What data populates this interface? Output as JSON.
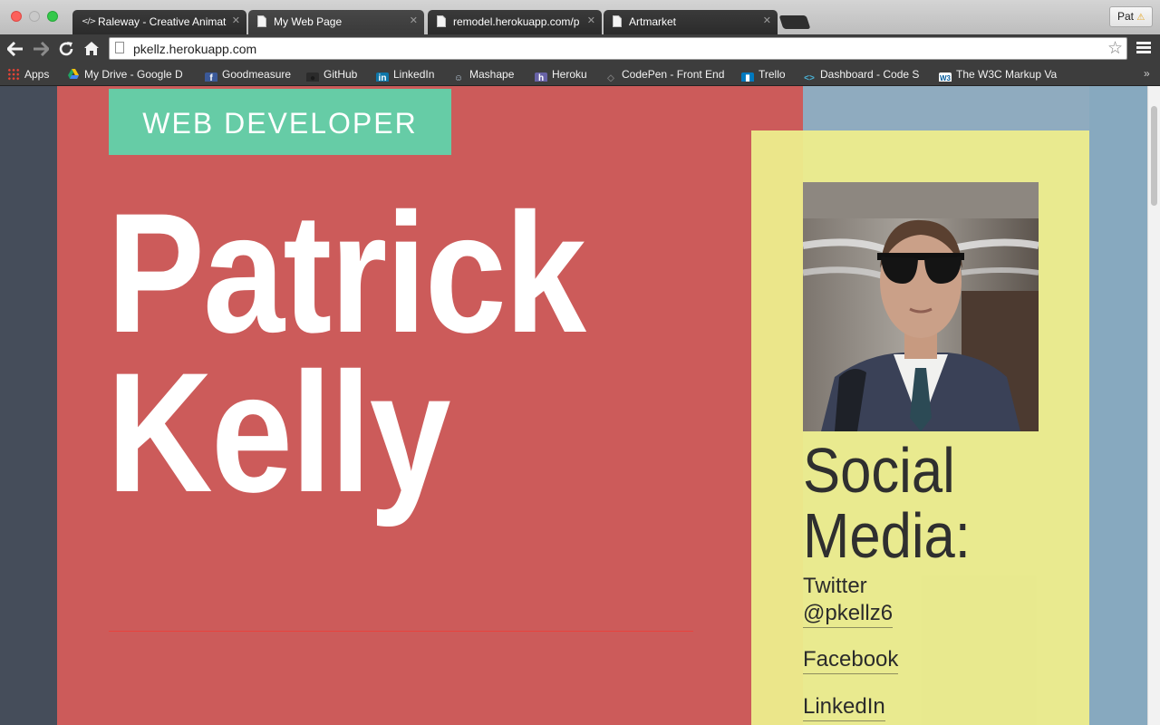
{
  "browser": {
    "tabs": [
      {
        "title": "Raleway - Creative Animat",
        "icon": "code-icon",
        "active": false
      },
      {
        "title": "My Web Page",
        "icon": "page-icon",
        "active": true
      },
      {
        "title": "remodel.herokuapp.com/p",
        "icon": "page-icon",
        "active": false
      },
      {
        "title": "Artmarket",
        "icon": "page-icon",
        "active": false
      }
    ],
    "profile": "Pat",
    "url": "pkellz.herokuapp.com",
    "bookmarks": [
      {
        "label": "Apps",
        "icon": "apps-grid-icon"
      },
      {
        "label": "My Drive - Google D",
        "icon": "google-drive-icon"
      },
      {
        "label": "Goodmeasure",
        "icon": "facebook-icon"
      },
      {
        "label": "GitHub",
        "icon": "github-icon"
      },
      {
        "label": "LinkedIn",
        "icon": "linkedin-icon"
      },
      {
        "label": "Mashape",
        "icon": "mashape-icon"
      },
      {
        "label": "Heroku",
        "icon": "heroku-icon"
      },
      {
        "label": "CodePen - Front End",
        "icon": "codepen-icon"
      },
      {
        "label": "Trello",
        "icon": "trello-icon"
      },
      {
        "label": "Dashboard - Code S",
        "icon": "code-school-icon"
      },
      {
        "label": "The W3C Markup Va",
        "icon": "w3c-icon"
      }
    ],
    "more": "»"
  },
  "page": {
    "badge": "WEB DEVELOPER",
    "name_line1": "Patrick",
    "name_line2": "Kelly",
    "social_heading_line1": "Social",
    "social_heading_line2": "Media:",
    "twitter_label": "Twitter",
    "twitter_handle": "@pkellz6",
    "facebook": "Facebook",
    "linkedin": "LinkedIn"
  },
  "colors": {
    "hero": "#cc5b5a",
    "badge": "#66cca6",
    "sidebar": "#ecec8c",
    "right_panel": "#8fabbf",
    "left_panel": "#454d5a"
  }
}
